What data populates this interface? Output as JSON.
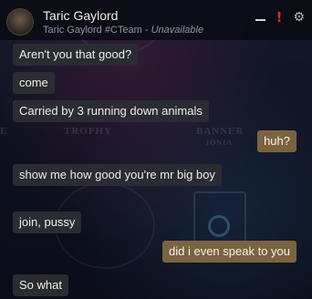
{
  "header": {
    "name": "Taric Gaylord",
    "handle": "Taric Gaylord #CTeam",
    "separator": " - ",
    "status": "Unavailable"
  },
  "background": {
    "left_label": "E",
    "trophy_label": "TROPHY",
    "banner_label": "BANNER",
    "region_label": "IONIA"
  },
  "icons": {
    "minimize": "minimize-icon",
    "alert": "!",
    "settings": "⚙"
  },
  "messages": [
    {
      "from": "them",
      "text": "Aren't you that good?"
    },
    {
      "from": "them",
      "text": "come"
    },
    {
      "from": "them",
      "text": "Carried by 3 running down animals"
    },
    {
      "from": "me",
      "text": "huh?"
    },
    {
      "from": "them",
      "text": "show me how good you're mr big boy"
    },
    {
      "from": "them",
      "text": "join, pussy"
    },
    {
      "from": "me",
      "text": "did i even speak to you"
    },
    {
      "from": "them",
      "text": "So what"
    }
  ],
  "colors": {
    "incoming_bubble": "#2a2c31",
    "outgoing_bubble": "#7b6340",
    "alert": "#d8253a"
  }
}
